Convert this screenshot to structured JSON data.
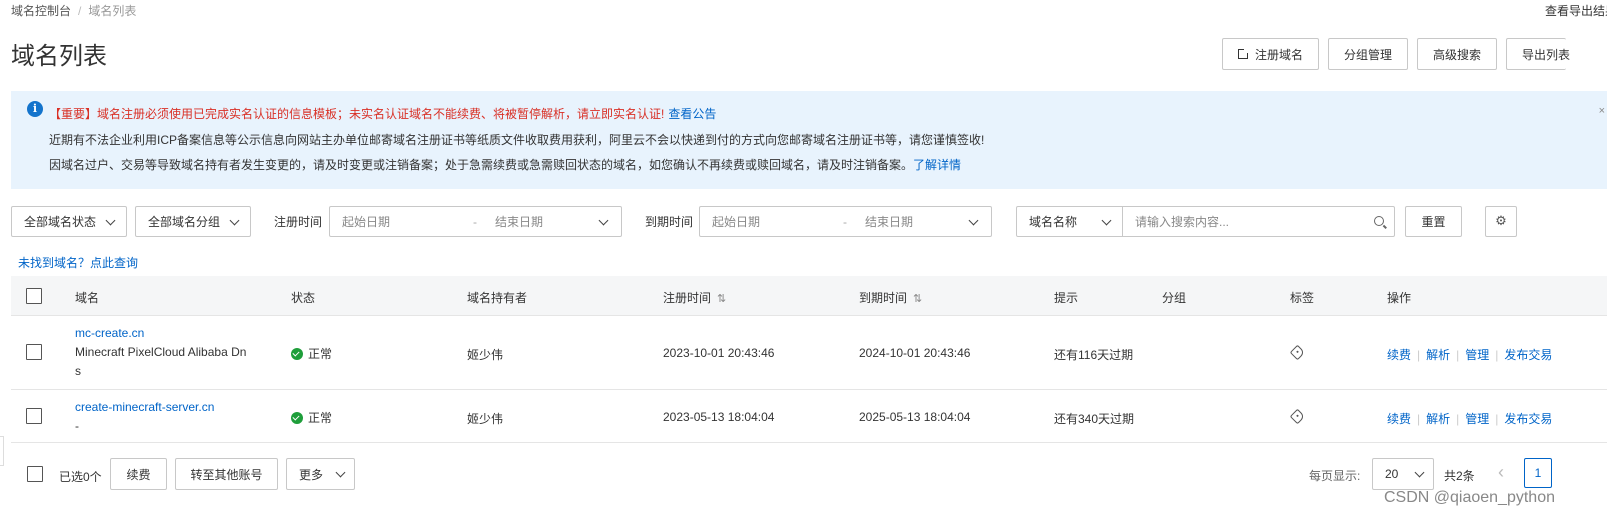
{
  "breadcrumb": {
    "root": "域名控制台",
    "separator": "/",
    "current": "域名列表"
  },
  "top_right_link": "查看导出结果",
  "page_title": "域名列表",
  "top_buttons": {
    "register": "注册域名",
    "group_manage": "分组管理",
    "advanced_search": "高级搜索",
    "export": "导出列表"
  },
  "notice": {
    "line1": "【重要】域名注册必须使用已完成实名认证的信息模板；未实名认证域名不能续费、将被暂停解析，请立即实名认证!",
    "line1_link": "查看公告",
    "line2": "近期有不法企业利用ICP备案信息等公示信息向网站主办单位邮寄域名注册证书等纸质文件收取费用获利，阿里云不会以快递到付的方式向您邮寄域名注册证书等，请您谨慎签收!",
    "line3": "因域名过户、交易等导致域名持有者发生变更的，请及时变更或注销备案；处于急需续费或急需赎回状态的域名，如您确认不再续费或赎回域名，请及时注销备案。",
    "line3_link": "了解详情",
    "close": "×"
  },
  "filters": {
    "status": "全部域名状态",
    "group": "全部域名分组",
    "reg_time_label": "注册时间",
    "reg_start": "起始日期",
    "reg_end": "结束日期",
    "exp_time_label": "到期时间",
    "exp_start": "起始日期",
    "exp_end": "结束日期",
    "date_sep": "-",
    "search_field": "域名名称",
    "search_placeholder": "请输入搜索内容...",
    "reset": "重置"
  },
  "not_found_link": "未找到域名？点此查询",
  "table": {
    "headers": {
      "domain": "域名",
      "status": "状态",
      "holder": "域名持有者",
      "reg_time": "注册时间",
      "exp_time": "到期时间",
      "hint": "提示",
      "group": "分组",
      "tag": "标签",
      "ops": "操作"
    },
    "sort_icon": "⇅",
    "rows": [
      {
        "domain": "mc-create.cn",
        "note1": "Minecraft PixelCloud Alibaba Dn",
        "note2": "s",
        "status": "正常",
        "holder": "姬少伟",
        "reg_time": "2023-10-01 20:43:46",
        "exp_time": "2024-10-01 20:43:46",
        "hint": "还有116天过期",
        "ops": [
          "续费",
          "解析",
          "管理",
          "发布交易"
        ]
      },
      {
        "domain": "create-minecraft-server.cn",
        "note1": "-",
        "status": "正常",
        "holder": "姬少伟",
        "reg_time": "2023-05-13 18:04:04",
        "exp_time": "2025-05-13 18:04:04",
        "hint": "还有340天过期",
        "ops": [
          "续费",
          "解析",
          "管理",
          "发布交易"
        ]
      }
    ]
  },
  "footer": {
    "selected": "已选0个",
    "renew": "续费",
    "transfer": "转至其他账号",
    "more": "更多",
    "per_page_label": "每页显示:",
    "per_page": "20",
    "total": "共2条",
    "prev": "‹",
    "page": "1"
  },
  "watermark": "CSDN @qiaoen_python",
  "icons": [
    "external-link-icon",
    "info-icon",
    "chevron-down-icon",
    "search-icon",
    "gear-icon",
    "check-circle-icon",
    "tag-icon",
    "sort-icon",
    "prev-page-icon"
  ],
  "colors": {
    "link": "#0064c8",
    "notice_bg": "#e8f3fd",
    "warning": "#d93026",
    "success": "#1e9e3a"
  }
}
